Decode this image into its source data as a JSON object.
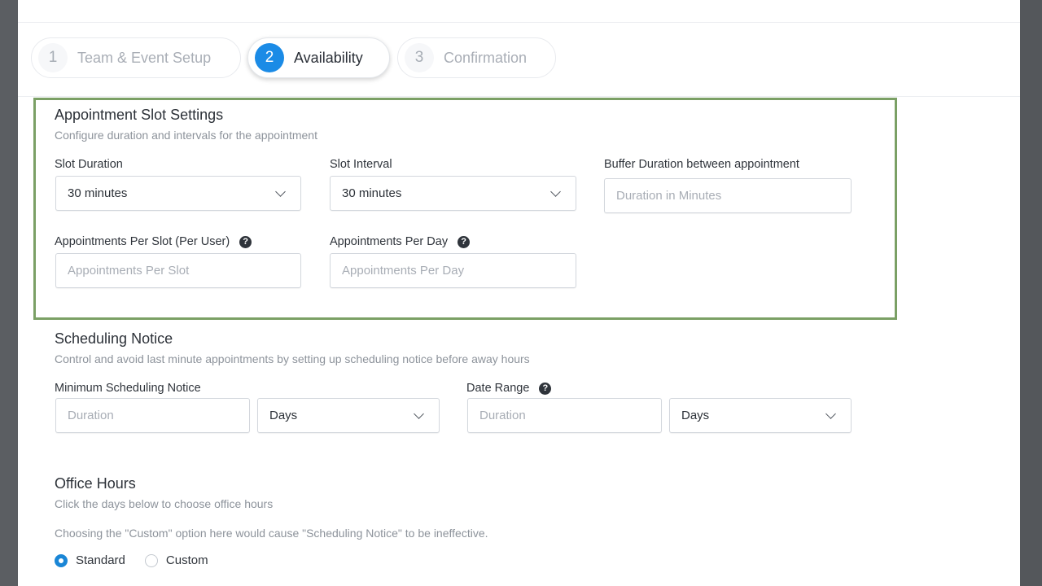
{
  "steps": [
    {
      "number": "1",
      "label": "Team & Event Setup",
      "active": false
    },
    {
      "number": "2",
      "label": "Availability",
      "active": true
    },
    {
      "number": "3",
      "label": "Confirmation",
      "active": false
    }
  ],
  "slot_settings": {
    "title": "Appointment Slot Settings",
    "subtitle": "Configure duration and intervals for the appointment",
    "slot_duration": {
      "label": "Slot Duration",
      "value": "30 minutes"
    },
    "slot_interval": {
      "label": "Slot Interval",
      "value": "30 minutes"
    },
    "buffer_duration": {
      "label": "Buffer Duration between appointment",
      "placeholder": "Duration in Minutes"
    },
    "per_slot": {
      "label": "Appointments Per Slot (Per User)",
      "placeholder": "Appointments Per Slot"
    },
    "per_day": {
      "label": "Appointments Per Day",
      "placeholder": "Appointments Per Day"
    }
  },
  "scheduling_notice": {
    "title": "Scheduling Notice",
    "subtitle": "Control and avoid last minute appointments by setting up scheduling notice before away hours",
    "minimum": {
      "label": "Minimum Scheduling Notice",
      "placeholder": "Duration",
      "unit": "Days"
    },
    "date_range": {
      "label": "Date Range",
      "placeholder": "Duration",
      "unit": "Days"
    }
  },
  "office_hours": {
    "title": "Office Hours",
    "subtitle": "Click the days below to choose office hours",
    "note": "Choosing the \"Custom\" option here would cause \"Scheduling Notice\" to be ineffective.",
    "options": [
      {
        "label": "Standard",
        "checked": true
      },
      {
        "label": "Custom",
        "checked": false
      }
    ]
  },
  "icons": {
    "help": "question-circle-icon",
    "chevron": "chevron-down-icon",
    "help_glyph": "?"
  },
  "colors": {
    "accent": "#1b8be6",
    "highlight_border": "#7ba065"
  }
}
